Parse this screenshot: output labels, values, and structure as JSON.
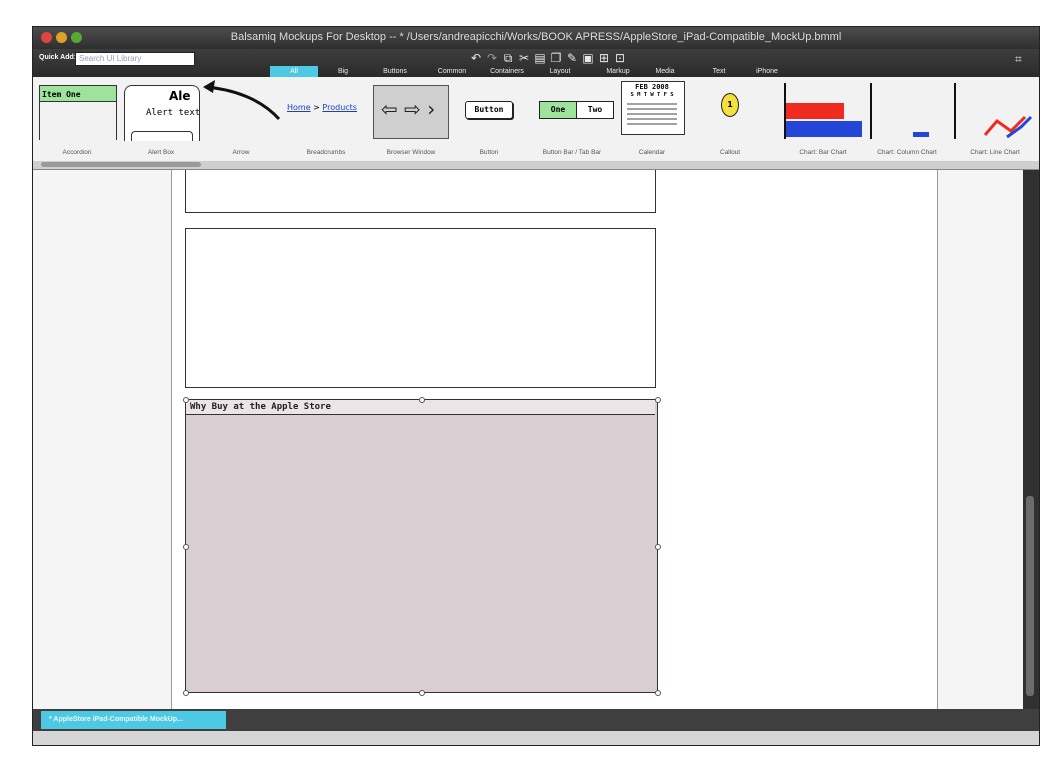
{
  "window": {
    "title": "Balsamiq Mockups For Desktop -- * /Users/andreapicchi/Works/BOOK APRESS/AppleStore_iPad-Compatible_MockUp.bmml",
    "traffic_colors": {
      "close": "#e0443e",
      "minimize": "#dea123",
      "zoom": "#5aa834"
    }
  },
  "toolbar": {
    "quick_add_label": "Quick Add:",
    "quick_add_placeholder": "Search UI Library",
    "icons": [
      "undo-icon",
      "redo-icon",
      "copy-icon",
      "cut-icon",
      "paste-icon",
      "duplicate-icon",
      "edit-icon",
      "group-icon",
      "ungroup-icon",
      "lock-icon"
    ],
    "fullscreen_icon": "fullscreen-icon"
  },
  "tabs": [
    {
      "label": "All",
      "active": true
    },
    {
      "label": "Big",
      "active": false
    },
    {
      "label": "Buttons",
      "active": false
    },
    {
      "label": "Common",
      "active": false
    },
    {
      "label": "Containers",
      "active": false
    },
    {
      "label": "Layout",
      "active": false
    },
    {
      "label": "Markup",
      "active": false
    },
    {
      "label": "Media",
      "active": false
    },
    {
      "label": "Text",
      "active": false
    },
    {
      "label": "iPhone",
      "active": false
    }
  ],
  "library": {
    "accordion": {
      "label": "Accordion",
      "item": "Item One"
    },
    "alert": {
      "label": "Alert Box",
      "title": "Ale",
      "text": "Alert text"
    },
    "arrow": {
      "label": "Arrow"
    },
    "breadcrumbs": {
      "label": "Breadcrumbs",
      "home": "Home",
      "sep": ">",
      "products": "Products"
    },
    "browser": {
      "label": "Browser Window"
    },
    "button": {
      "label": "Button",
      "text": "Button"
    },
    "buttonbar": {
      "label": "Button Bar / Tab Bar",
      "one": "One",
      "two": "Two"
    },
    "calendar": {
      "label": "Calendar",
      "month": "FEB 2008",
      "days": "S M T W T F S"
    },
    "callout": {
      "label": "Callout",
      "number": "1"
    },
    "bar_chart": {
      "label": "Chart: Bar Chart"
    },
    "column_chart": {
      "label": "Chart: Column Chart"
    },
    "line_chart": {
      "label": "Chart: Line Chart"
    }
  },
  "canvas": {
    "window_title": "Why Buy at the Apple Store",
    "window_fill": "#d9cfd3"
  },
  "status": {
    "doc_tab": "* AppleStore iPad-Compatible MockUp..."
  }
}
